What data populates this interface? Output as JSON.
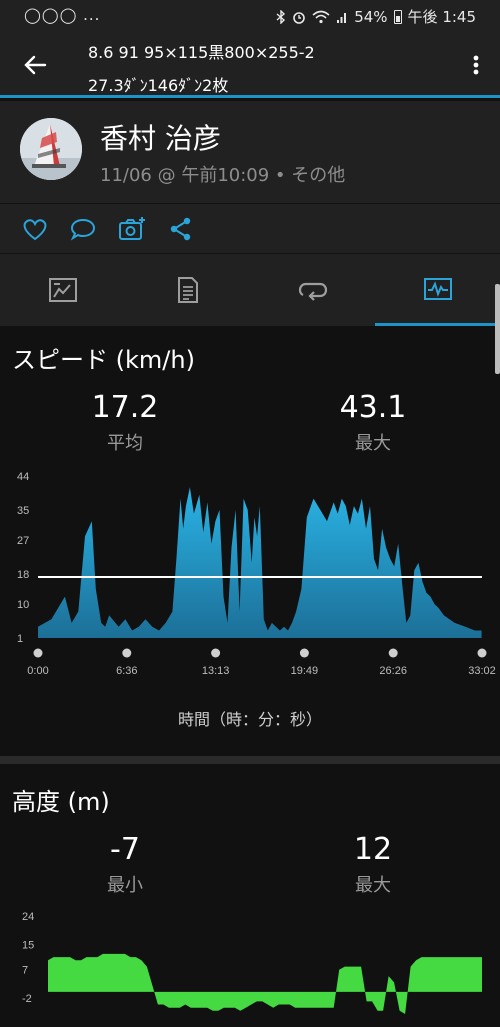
{
  "status": {
    "left_icons": "◯◯◯ ...",
    "battery": "54%",
    "time": "午後 1:45"
  },
  "appbar": {
    "line1": "8.6 91 95×115黒800×255-2",
    "line2": "27.3ﾀﾞﾝ146ﾀﾞﾝ2枚"
  },
  "activity": {
    "name": "香村 治彦",
    "meta": "11/06 @ 午前10:09 • その他"
  },
  "icons": {
    "back": "arrow-left-icon",
    "menu": "more-vert-icon",
    "like": "heart-icon",
    "comment": "comment-icon",
    "photo": "add-photo-icon",
    "share": "share-icon",
    "tabs": [
      "overview-icon",
      "details-icon",
      "laps-icon",
      "charts-icon"
    ]
  },
  "colors": {
    "accent": "#1e93c8",
    "speed_fill": "#2aa4d9",
    "elev_fill": "#45d942"
  },
  "speed": {
    "title": "スピード (km/h)",
    "avg_value": "17.2",
    "avg_label": "平均",
    "max_value": "43.1",
    "max_label": "最大",
    "x_caption": "時間（時：分：秒）"
  },
  "elevation": {
    "title": "高度 (m)",
    "min_value": "-7",
    "min_label": "最小",
    "max_value": "12",
    "max_label": "最大"
  },
  "chart_data": [
    {
      "type": "area",
      "ylim": [
        1,
        44
      ],
      "y_ticks": [
        "44",
        "35",
        "27",
        "18",
        "10",
        "1"
      ],
      "x_ticks": [
        "0:00",
        "6:36",
        "13:13",
        "19:49",
        "26:26",
        "33:02"
      ],
      "x_minutes": [
        0,
        1,
        2,
        2.5,
        3,
        3.5,
        4,
        4.3,
        4.7,
        5,
        5.3,
        6,
        6.5,
        7,
        7.5,
        8,
        8.5,
        9,
        9.5,
        10,
        10.3,
        10.6,
        10.8,
        11,
        11.3,
        11.6,
        12,
        12.3,
        12.6,
        12.9,
        13.2,
        13.5,
        13.8,
        14.1,
        14.4,
        14.7,
        15,
        15.3,
        15.6,
        15.9,
        16.1,
        16.3,
        16.5,
        16.8,
        17.1,
        17.4,
        17.7,
        18,
        18.3,
        18.6,
        18.9,
        19.2,
        19.6,
        20,
        20.5,
        21,
        21.5,
        22,
        22.3,
        22.6,
        22.9,
        23.2,
        23.5,
        23.8,
        24.1,
        24.4,
        24.7,
        25,
        25.3,
        25.6,
        25.9,
        26.2,
        26.5,
        26.8,
        27.1,
        27.4,
        27.7,
        28,
        28.3,
        28.6,
        28.9,
        29.2,
        29.5,
        29.8,
        30.2,
        31,
        31.8,
        32.5,
        33.0
      ],
      "values": [
        4,
        6,
        12,
        5,
        8,
        28,
        32,
        14,
        5,
        4,
        7,
        4,
        6,
        3,
        4,
        6,
        4,
        3,
        5,
        8,
        22,
        38,
        30,
        36,
        41,
        34,
        39,
        29,
        37,
        26,
        32,
        35,
        12,
        5,
        25,
        35,
        8,
        38,
        35,
        21,
        33,
        28,
        36,
        6,
        3,
        5,
        4,
        3,
        4,
        3,
        5,
        8,
        14,
        33,
        38,
        35,
        32,
        37,
        34,
        38,
        36,
        31,
        36,
        34,
        38,
        30,
        36,
        22,
        19,
        30,
        25,
        22,
        20,
        26,
        15,
        5,
        7,
        19,
        21,
        16,
        13,
        12,
        10,
        9,
        7,
        5,
        4,
        3,
        3
      ],
      "reference_line": 17.2
    },
    {
      "type": "area",
      "ylim": [
        -7,
        24
      ],
      "y_ticks": [
        "24",
        "15",
        "7",
        "-2"
      ],
      "values": [
        10,
        11,
        11,
        11,
        11,
        10,
        10,
        11,
        11,
        11,
        12,
        12,
        12,
        12,
        12,
        11,
        11,
        10,
        8,
        2,
        -4,
        -4,
        -5,
        -5,
        -5,
        -4,
        -5,
        -5,
        -5,
        -5,
        -6,
        -6,
        -5,
        -5,
        -5,
        -6,
        -5,
        -4,
        -3,
        -3,
        -4,
        -5,
        -4,
        -4,
        -4,
        -5,
        -5,
        -5,
        -5,
        -5,
        -5,
        -5,
        -5,
        7,
        8,
        8,
        8,
        8,
        -3,
        -3,
        -6,
        -6,
        5,
        3,
        -6,
        -7,
        8,
        10,
        11,
        11,
        11,
        11,
        11,
        11,
        11,
        11,
        11,
        11,
        11,
        11
      ]
    }
  ]
}
